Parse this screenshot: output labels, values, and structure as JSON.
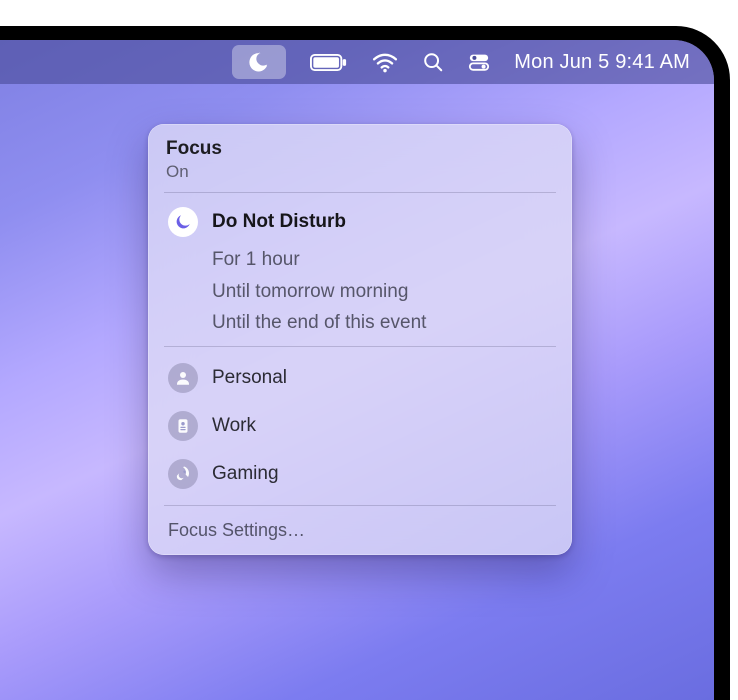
{
  "menubar": {
    "clock": "Mon Jun 5  9:41 AM"
  },
  "panel": {
    "title": "Focus",
    "status": "On",
    "active_mode": {
      "label": "Do Not Disturb",
      "options": [
        "For 1 hour",
        "Until tomorrow morning",
        "Until the end of this event"
      ]
    },
    "modes": [
      {
        "label": "Personal",
        "icon": "person"
      },
      {
        "label": "Work",
        "icon": "badge"
      },
      {
        "label": "Gaming",
        "icon": "rocket"
      }
    ],
    "footer": "Focus Settings…"
  }
}
